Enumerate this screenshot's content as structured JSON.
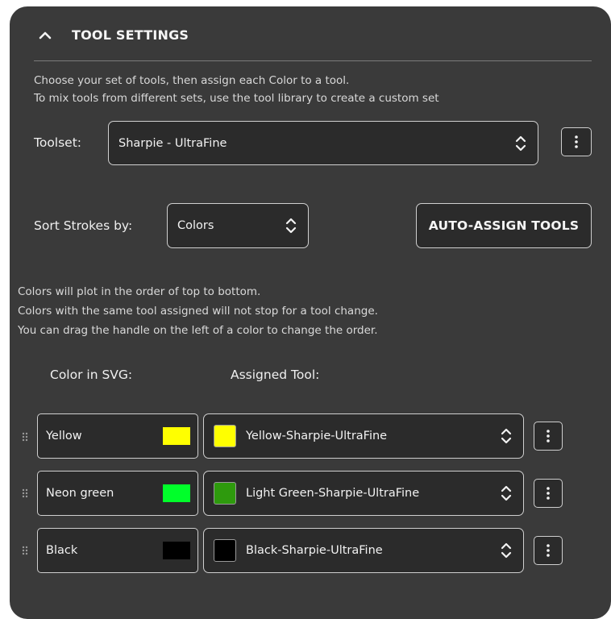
{
  "header": {
    "title": "TOOL SETTINGS",
    "toggle_icon": "chevron-up-icon"
  },
  "intro": {
    "line1": "Choose your set of tools, then assign each Color to a tool.",
    "line2": "To mix tools from different sets, use the tool library to create a custom set"
  },
  "toolset": {
    "label": "Toolset:",
    "value": "Sharpie - UltraFine"
  },
  "sort": {
    "label": "Sort Strokes by:",
    "value": "Colors"
  },
  "auto_assign_label": "AUTO-ASSIGN TOOLS",
  "info": {
    "line1": "Colors will plot in the order of top to bottom.",
    "line2": "Colors with the same tool assigned will not stop for a tool change.",
    "line3": "You can drag the handle on the left of a color to change the order."
  },
  "columns": {
    "color": "Color in SVG:",
    "tool": "Assigned Tool:"
  },
  "rows": [
    {
      "color_name": "Yellow",
      "color_hex": "#ffff00",
      "tool": "Yellow-Sharpie-UltraFine",
      "tool_hex": "#ffff00"
    },
    {
      "color_name": "Neon green",
      "color_hex": "#00ff2a",
      "tool": "Light Green-Sharpie-UltraFine",
      "tool_hex": "#2e9a0d"
    },
    {
      "color_name": "Black",
      "color_hex": "#000000",
      "tool": "Black-Sharpie-UltraFine",
      "tool_hex": "#000000"
    }
  ],
  "colors": {
    "panel_bg": "#3a3a3a",
    "field_bg": "#2b2b2b",
    "border": "#cfcfcf"
  }
}
